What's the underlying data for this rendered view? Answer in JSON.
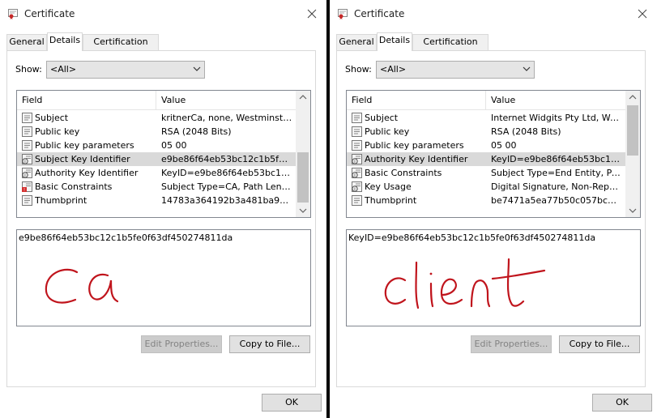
{
  "windows": [
    {
      "title": "Certificate",
      "tabs": [
        "General",
        "Details",
        "Certification Path"
      ],
      "active_tab": "Details",
      "show_label": "Show:",
      "show_value": "<All>",
      "columns": [
        "Field",
        "Value"
      ],
      "rows": [
        {
          "field": "Subject",
          "value": "kritnerCa, none, Westminster,...",
          "icon": "cert-field-icon"
        },
        {
          "field": "Public key",
          "value": "RSA (2048 Bits)",
          "icon": "cert-field-icon"
        },
        {
          "field": "Public key parameters",
          "value": "05 00",
          "icon": "cert-field-icon"
        },
        {
          "field": "Subject Key Identifier",
          "value": "e9be86f64eb53bc12c1b5fe0f...",
          "icon": "extension-icon",
          "selected": true
        },
        {
          "field": "Authority Key Identifier",
          "value": "KeyID=e9be86f64eb53bc12c1...",
          "icon": "extension-icon"
        },
        {
          "field": "Basic Constraints",
          "value": "Subject Type=CA, Path Lengt...",
          "icon": "critical-extension-icon"
        },
        {
          "field": "Thumbprint",
          "value": "14783a364192b3a481ba97c5f...",
          "icon": "cert-field-icon"
        }
      ],
      "detail_text": "e9be86f64eb53bc12c1b5fe0f63df450274811da",
      "handwriting": "ca",
      "buttons": {
        "edit": "Edit Properties...",
        "copy": "Copy to File...",
        "ok": "OK"
      }
    },
    {
      "title": "Certificate",
      "tabs": [
        "General",
        "Details",
        "Certification Path"
      ],
      "active_tab": "Details",
      "show_label": "Show:",
      "show_value": "<All>",
      "columns": [
        "Field",
        "Value"
      ],
      "rows": [
        {
          "field": "Subject",
          "value": "Internet Widgits Pty Ltd, West...",
          "icon": "cert-field-icon"
        },
        {
          "field": "Public key",
          "value": "RSA (2048 Bits)",
          "icon": "cert-field-icon"
        },
        {
          "field": "Public key parameters",
          "value": "05 00",
          "icon": "cert-field-icon"
        },
        {
          "field": "Authority Key Identifier",
          "value": "KeyID=e9be86f64eb53bc12c1...",
          "icon": "extension-icon",
          "selected": true
        },
        {
          "field": "Basic Constraints",
          "value": "Subject Type=End Entity, Pat...",
          "icon": "extension-icon"
        },
        {
          "field": "Key Usage",
          "value": "Digital Signature, Non-Repudia...",
          "icon": "extension-icon"
        },
        {
          "field": "Thumbprint",
          "value": "be7471a5ea77b50c057bc303...",
          "icon": "cert-field-icon"
        }
      ],
      "detail_text": "KeyID=e9be86f64eb53bc12c1b5fe0f63df450274811da",
      "handwriting": "client",
      "buttons": {
        "edit": "Edit Properties...",
        "copy": "Copy to File...",
        "ok": "OK"
      }
    }
  ],
  "colors": {
    "selected_row": "#d9d9d9",
    "handwriting": "#c0141c"
  }
}
